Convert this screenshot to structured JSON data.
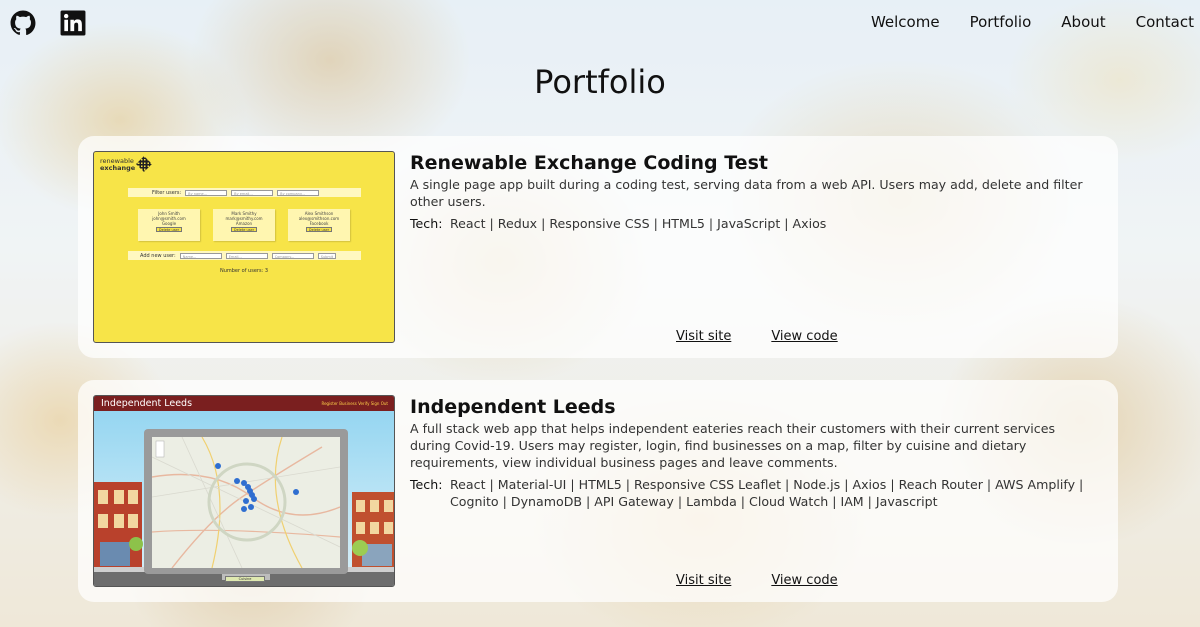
{
  "nav": {
    "links": [
      "Welcome",
      "Portfolio",
      "About",
      "Contact"
    ]
  },
  "social": {
    "github_icon": "github-icon",
    "linkedin_icon": "linkedin-icon"
  },
  "page": {
    "title": "Portfolio"
  },
  "projects": [
    {
      "title": "Renewable Exchange Coding Test",
      "description": "A single page app built during a coding test, serving data from a web API. Users may add, delete and filter other users.",
      "tech_label": "Tech:",
      "tech": "React | Redux | Responsive CSS | HTML5 | JavaScript | Axios",
      "visit_label": "Visit site",
      "code_label": "View code",
      "thumbnail": {
        "logo_line1": "renewable",
        "logo_line2": "exchange",
        "filter_label": "Filter users:",
        "filter_placeholders": [
          "By name...",
          "By email...",
          "By company..."
        ],
        "users": [
          {
            "name": "John Smith",
            "email": "john@smith.com",
            "company": "Google",
            "button": "Delete user"
          },
          {
            "name": "Mark Smithy",
            "email": "mark@smithy.com",
            "company": "Amazon",
            "button": "Delete user"
          },
          {
            "name": "Alex Smithson",
            "email": "alex@smithson.com",
            "company": "Facebook",
            "button": "Delete user"
          }
        ],
        "add_label": "Add new user:",
        "add_placeholders": [
          "Name...",
          "Email...",
          "Company..."
        ],
        "submit": "Submit",
        "count_text": "Number of users: 3"
      }
    },
    {
      "title": "Independent Leeds",
      "description": "A full stack web app that helps independent eateries reach their customers with their current services during Covid-19. Users may register, login, find businesses on a map, filter by cuisine and dietary requirements, view individual business pages and leave comments.",
      "tech_label": "Tech:",
      "tech": "React | Material-UI | HTML5 | Responsive CSS Leaflet | Node.js | Axios | Reach Router | AWS Amplify | Cognito | DynamoDB | API Gateway | Lambda | Cloud Watch | IAM | Javascript",
      "visit_label": "Visit site",
      "code_label": "View code",
      "thumbnail": {
        "header_title": "Independent Leeds",
        "header_links": "Register Business   Verify   Sign Out",
        "select_label": "Cuisine"
      }
    }
  ],
  "colors": {
    "thumb1_bg": "#f7e448",
    "thumb2_header": "#7a1f1f",
    "card_bg": "rgba(255,255,255,0.72)"
  }
}
